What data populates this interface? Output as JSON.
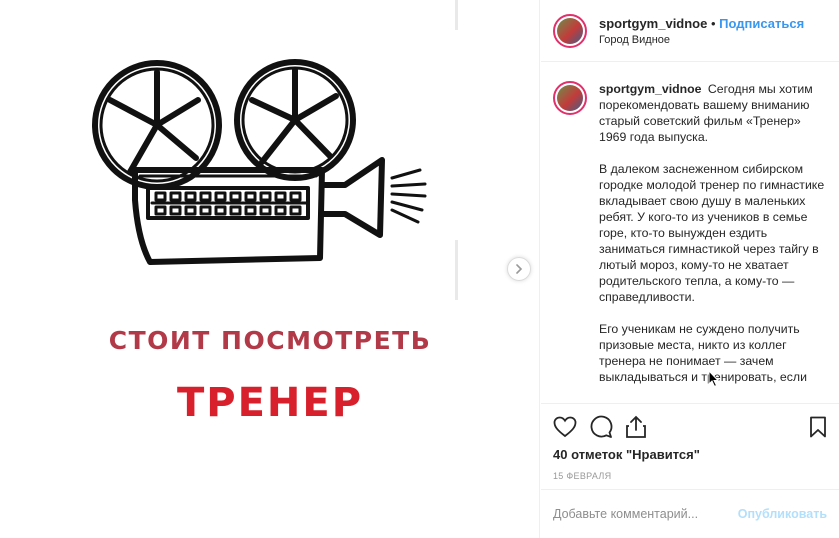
{
  "post": {
    "image": {
      "caption_top": "СТОИТ ПОСМОТРЕТЬ",
      "caption_title": "ТРЕНЕР",
      "caption_top_color": "#b23a48",
      "caption_title_color": "#d7202b",
      "illustration": "film-camera-drawing"
    },
    "header": {
      "username": "sportgym_vidnoe",
      "separator": "•",
      "follow_label": "Подписаться",
      "location": "Город Видное"
    },
    "comment": {
      "username": "sportgym_vidnoe",
      "paragraphs": [
        "Сегодня мы хотим порекомендовать вашему вниманию старый советский фильм «Тренер» 1969 года выпуска.",
        "В далеком заснеженном сибирском городке молодой тренер по гимнастике вкладывает свою душу в маленьких ребят. У кого-то из учеников в семье горе, кто-то вынужден ездить заниматься гимнастикой через тайгу в лютый мороз, кому-то не хватает родительского тепла, а кому-то — справедливости.",
        "Его ученикам не суждено получить призовые места, никто из коллег тренера не понимает — зачем выкладываться и тренировать, если"
      ]
    },
    "likes": "40 отметок \"Нравится\"",
    "date": "15 ФЕВРАЛЯ",
    "add_comment_placeholder": "Добавьте комментарий...",
    "publish_label": "Опубликовать",
    "accent_color": "#3897f0"
  }
}
